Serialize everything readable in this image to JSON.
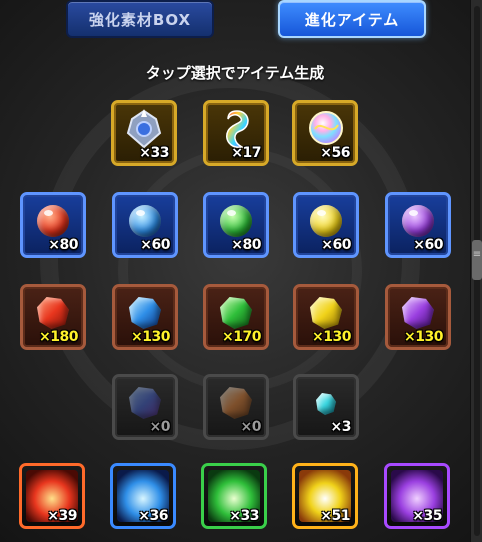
{
  "tabs": {
    "enhance_box_label": "強化素材BOX",
    "evolution_items_label": "進化アイテム"
  },
  "subtitle": "タップ選択でアイテム生成",
  "colors": {
    "red": "#e8361e",
    "blue": "#2f8fe8",
    "green": "#2fbf3a",
    "yellow": "#f0d21a",
    "purple": "#9a3fe0",
    "gold_frame": "#d7a928",
    "blue_frame": "#5f95ff",
    "brown_frame": "#a65a3c",
    "count_yellow": "#fff22a"
  },
  "rows": [
    {
      "name": "special",
      "items": [
        {
          "icon": "crystal-emblem-icon",
          "count": "×33"
        },
        {
          "icon": "rainbow-swirl-icon",
          "count": "×17"
        },
        {
          "icon": "rainbow-orb-icon",
          "count": "×56"
        }
      ]
    },
    {
      "name": "orbs",
      "items": [
        {
          "icon": "red-orb-icon",
          "count": "×80"
        },
        {
          "icon": "blue-orb-icon",
          "count": "×60"
        },
        {
          "icon": "green-orb-icon",
          "count": "×80"
        },
        {
          "icon": "yellow-orb-icon",
          "count": "×60"
        },
        {
          "icon": "purple-orb-icon",
          "count": "×60"
        }
      ]
    },
    {
      "name": "stones",
      "items": [
        {
          "icon": "red-stone-icon",
          "count": "×180"
        },
        {
          "icon": "blue-stone-icon",
          "count": "×130"
        },
        {
          "icon": "green-stone-icon",
          "count": "×170"
        },
        {
          "icon": "yellow-stone-icon",
          "count": "×130"
        },
        {
          "icon": "purple-stone-icon",
          "count": "×130"
        }
      ]
    },
    {
      "name": "rare-stones",
      "items": [
        {
          "icon": "blue-purple-stone-icon",
          "count": "×0"
        },
        {
          "icon": "orange-stone-icon",
          "count": "×0"
        },
        {
          "icon": "cyan-crystal-icon",
          "count": "×3"
        }
      ]
    },
    {
      "name": "statues",
      "items": [
        {
          "icon": "fire-statue-icon",
          "count": "×39"
        },
        {
          "icon": "water-statue-icon",
          "count": "×36"
        },
        {
          "icon": "wood-statue-icon",
          "count": "×33"
        },
        {
          "icon": "light-statue-icon",
          "count": "×51"
        },
        {
          "icon": "dark-statue-icon",
          "count": "×35"
        }
      ]
    }
  ]
}
